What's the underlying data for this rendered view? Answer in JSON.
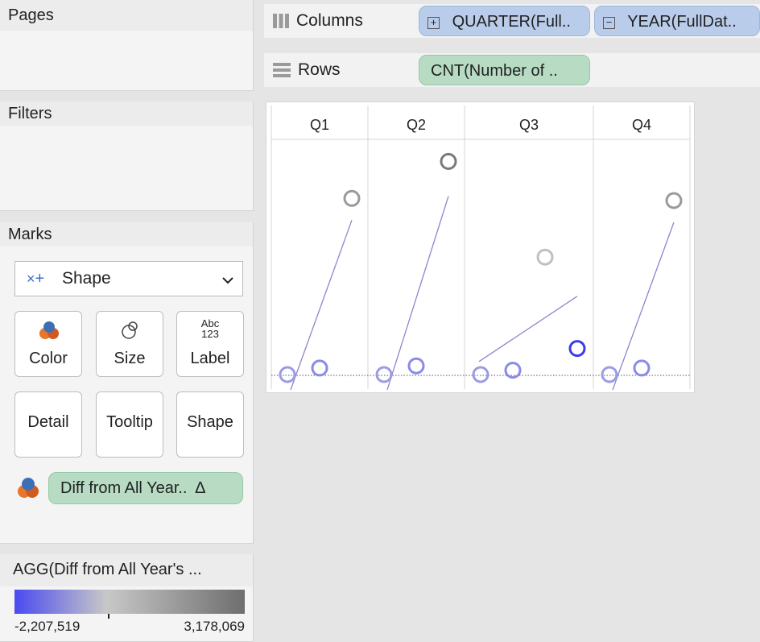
{
  "cards": {
    "pages_title": "Pages",
    "filters_title": "Filters",
    "marks_title": "Marks",
    "legend_title": "AGG(Diff from All Year's ..."
  },
  "shelves": {
    "columns_label": "Columns",
    "rows_label": "Rows",
    "columns_pills": [
      {
        "label": "QUARTER(Full..",
        "toggle": "+"
      },
      {
        "label": "YEAR(FullDat..",
        "toggle": "−"
      }
    ],
    "rows_pill": "CNT(Number of .."
  },
  "marks": {
    "mark_type": "Shape",
    "buttons": {
      "color": "Color",
      "size": "Size",
      "label": "Label",
      "detail": "Detail",
      "tooltip": "Tooltip",
      "shape": "Shape"
    },
    "label_icon_text_top": "Abc",
    "label_icon_text_bottom": "123",
    "color_field": "Diff from All Year..",
    "color_field_symbol": "Δ"
  },
  "legend": {
    "min": "-2,207,519",
    "max": "3,178,069",
    "colors": [
      "#4a4af0",
      "#c8c8c8",
      "#6e6e6e"
    ]
  },
  "chart_data": {
    "type": "scatter",
    "categories": [
      "Q1",
      "Q2",
      "Q3",
      "Q4"
    ],
    "description_free": true,
    "points": [
      {
        "quarter": "Q1",
        "year_index": 1,
        "y": 0.0,
        "color": "#9b9be6"
      },
      {
        "quarter": "Q1",
        "year_index": 2,
        "y": 0.03,
        "color": "#8a8ae8"
      },
      {
        "quarter": "Q1",
        "year_index": 3,
        "y": 0.81,
        "color": "#9a9a9a"
      },
      {
        "quarter": "Q2",
        "year_index": 1,
        "y": 0.0,
        "color": "#9b9be6"
      },
      {
        "quarter": "Q2",
        "year_index": 2,
        "y": 0.04,
        "color": "#8a8ae8"
      },
      {
        "quarter": "Q2",
        "year_index": 3,
        "y": 0.98,
        "color": "#7a7a7a"
      },
      {
        "quarter": "Q3",
        "year_index": 1,
        "y": 0.0,
        "color": "#9b9be6"
      },
      {
        "quarter": "Q3",
        "year_index": 2,
        "y": 0.02,
        "color": "#8a8ae8"
      },
      {
        "quarter": "Q3",
        "year_index": 3,
        "y": 0.54,
        "color": "#c0c0c0"
      },
      {
        "quarter": "Q3",
        "year_index": 4,
        "y": 0.12,
        "color": "#3b3be8"
      },
      {
        "quarter": "Q4",
        "year_index": 1,
        "y": 0.0,
        "color": "#9b9be6"
      },
      {
        "quarter": "Q4",
        "year_index": 2,
        "y": 0.03,
        "color": "#8a8ae8"
      },
      {
        "quarter": "Q4",
        "year_index": 3,
        "y": 0.8,
        "color": "#9a9a9a"
      }
    ],
    "trend_lines": [
      {
        "quarter": "Q1",
        "y_start": -0.07,
        "y_end": 0.71
      },
      {
        "quarter": "Q2",
        "y_start": -0.07,
        "y_end": 0.82
      },
      {
        "quarter": "Q3",
        "y_start": 0.06,
        "y_end": 0.36
      },
      {
        "quarter": "Q4",
        "y_start": -0.07,
        "y_end": 0.7
      }
    ],
    "grid": false
  }
}
